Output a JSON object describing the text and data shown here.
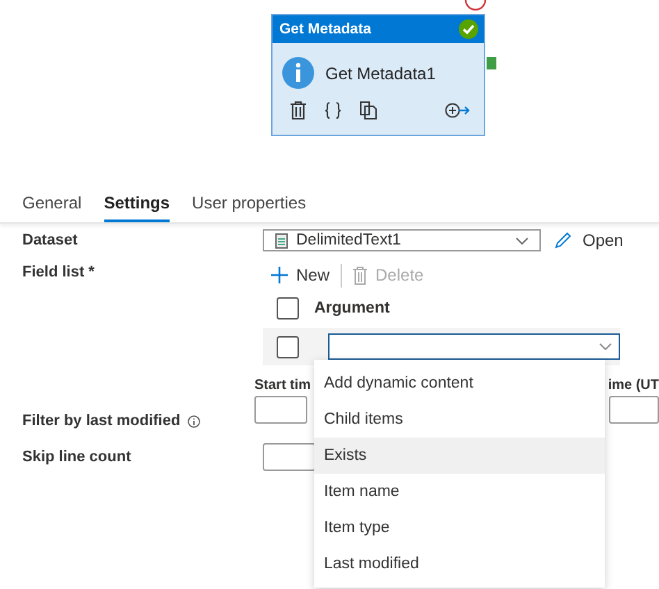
{
  "canvas": {
    "activity": {
      "header": "Get Metadata",
      "succeeded": true,
      "name": "Get Metadata1"
    }
  },
  "tabs": [
    {
      "label": "General",
      "selected": false
    },
    {
      "label": "Settings",
      "selected": true
    },
    {
      "label": "User properties",
      "selected": false
    }
  ],
  "settings": {
    "dataset": {
      "label": "Dataset",
      "value": "DelimitedText1",
      "open_link": "Open"
    },
    "field_list": {
      "label": "Field list",
      "required_mark": "*",
      "new": {
        "label": "New",
        "disabled": false
      },
      "delete": {
        "label": "Delete",
        "disabled": true
      },
      "column_header": "Argument",
      "header_checked": false,
      "rows": [
        {
          "checked": false,
          "open": true
        }
      ]
    },
    "dropdown": {
      "options": [
        {
          "label": "Add dynamic content",
          "highlighted": false
        },
        {
          "label": "Child items",
          "highlighted": false
        },
        {
          "label": "Exists",
          "highlighted": true
        },
        {
          "label": "Item name",
          "highlighted": false
        },
        {
          "label": "Item type",
          "highlighted": false
        },
        {
          "label": "Last modified",
          "highlighted": false
        }
      ]
    },
    "filter": {
      "label": "Filter by last modified",
      "start_label": "Start tim",
      "end_label": "ime (UT"
    },
    "skip_line_count": {
      "label": "Skip line count"
    }
  }
}
